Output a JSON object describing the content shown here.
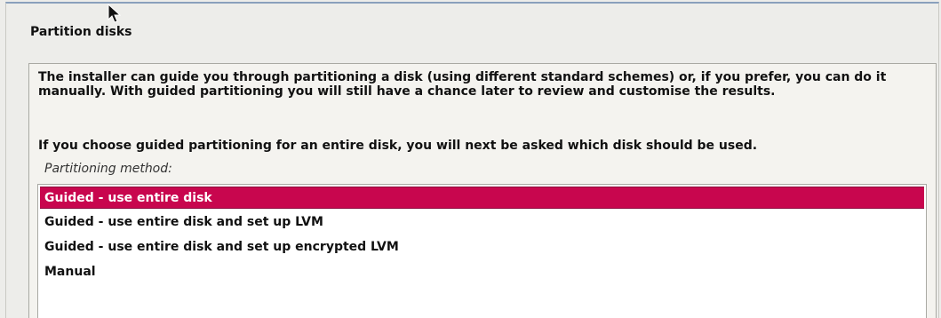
{
  "dialog": {
    "title": "Partition disks",
    "intro_text": "The installer can guide you through partitioning a disk (using different standard schemes) or, if you prefer, you can do it manually. With guided partitioning you will still have a chance later to review and customise the results.",
    "guided_note": "If you choose guided partitioning for an entire disk, you will next be asked which disk should be used.",
    "method_label": "Partitioning method:"
  },
  "partitioning_options": [
    {
      "label": "Guided - use entire disk",
      "selected": true
    },
    {
      "label": "Guided - use entire disk and set up LVM",
      "selected": false
    },
    {
      "label": "Guided - use entire disk and set up encrypted LVM",
      "selected": false
    },
    {
      "label": "Manual",
      "selected": false
    }
  ],
  "icons": {
    "cursor": "mouse-pointer-icon"
  },
  "colors": {
    "selection": "#c8064e",
    "window_border": "#8aa0bc"
  }
}
